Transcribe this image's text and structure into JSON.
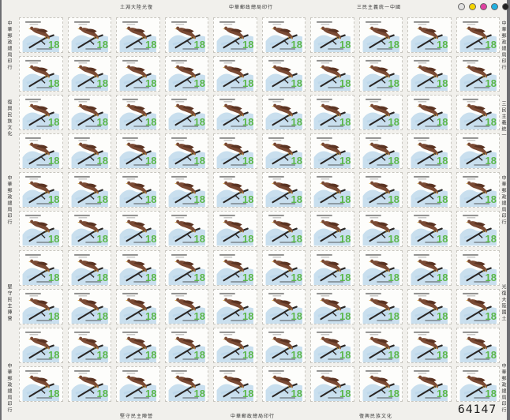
{
  "sheet": {
    "stamp_count": 100,
    "columns": 10,
    "rows": 10,
    "denomination": "18",
    "sheet_number": "64147",
    "colors": {
      "background_outside": "#6d6e72",
      "paper": "#f1f0ec",
      "sky": "#b7d4ea",
      "bird": "#7a4a34",
      "branch": "#2a2624",
      "denomination_green": "#5bb84a",
      "caption": "#333333"
    },
    "bird_icon": "hawk-on-branch",
    "registration_dot_colors": [
      "#e0e0e0",
      "#f4d400",
      "#e040a0",
      "#20b0e0",
      "#222222"
    ]
  },
  "margins": {
    "top_left": "土淵大陸光復",
    "top_center": "中華郵政總局印行",
    "top_right": "三民主義統一中國",
    "bottom_left": "堅守民主陣營",
    "bottom_center": "中華郵政總局印行",
    "bottom_right": "復興民族文化",
    "left_top": "中華郵政總局印行",
    "left_upper_mid": "復興民族文化",
    "left_lower_mid": "中華郵政總局印行",
    "left_mid_lower": "堅守民主陣營",
    "left_bottom": "中華郵政總局印行",
    "right_top": "中華郵政總局印行",
    "right_upper_mid": "三民主義統一",
    "right_mid": "中華郵政總局印行",
    "right_lower_mid": "光復大陸國土",
    "right_bottom": "中華郵政總局印行"
  }
}
